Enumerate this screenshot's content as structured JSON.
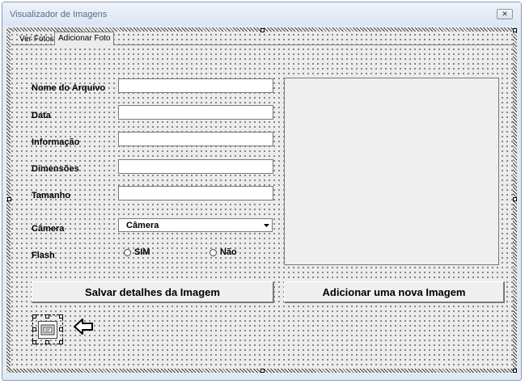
{
  "window": {
    "title": "Visualizador de Imagens",
    "close_symbol": "✕"
  },
  "tabs": [
    {
      "label": "Ver Fotos",
      "active": false
    },
    {
      "label": "Adicionar Foto",
      "active": true
    }
  ],
  "form": {
    "fields": [
      {
        "label": "Nome do Arquivo",
        "value": ""
      },
      {
        "label": "Data",
        "value": ""
      },
      {
        "label": "Informação",
        "value": ""
      },
      {
        "label": "Dimensões",
        "value": ""
      },
      {
        "label": "Tamanho",
        "value": ""
      }
    ],
    "camera": {
      "label": "Câmera",
      "selected": "Câmera"
    },
    "flash": {
      "label": "Flash",
      "options": [
        "SIM",
        "Não"
      ]
    }
  },
  "buttons": {
    "save": "Salvar detalhes da Imagem",
    "add": "Adicionar uma nova Imagem"
  },
  "icons": {
    "selected_control": "command-button-icon",
    "pointer": "left-arrow-icon"
  }
}
